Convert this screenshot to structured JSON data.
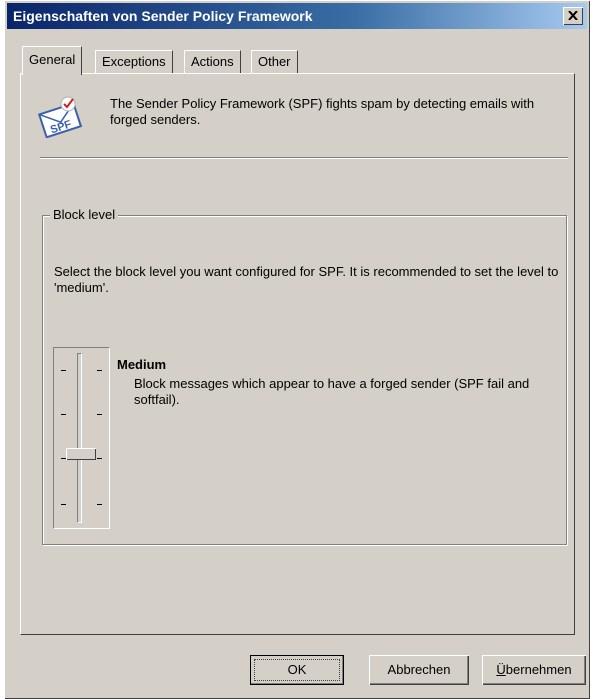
{
  "window": {
    "title": "Eigenschaften von Sender Policy Framework",
    "close_glyph": "×"
  },
  "tabs": [
    {
      "label": "General",
      "active": true
    },
    {
      "label": "Exceptions",
      "active": false
    },
    {
      "label": "Actions",
      "active": false
    },
    {
      "label": "Other",
      "active": false
    }
  ],
  "general": {
    "icon": "spf-envelope-icon",
    "description": "The Sender Policy Framework (SPF) fights spam by detecting emails with forged senders.",
    "group_title": "Block level",
    "group_text": "Select the block level you want configured for SPF.  It is recommended to set the level to 'medium'.",
    "level": {
      "name": "Medium",
      "description": "Block messages which appear to have a forged sender (SPF fail and softfail).",
      "position": 0.625
    }
  },
  "buttons": {
    "ok": "OK",
    "cancel": "Abbrechen",
    "apply_first": "Ü",
    "apply_rest": "bernehmen"
  },
  "colors": {
    "face": "#d4d0c8",
    "title_start": "#0a246a",
    "title_end": "#a6caf0"
  }
}
